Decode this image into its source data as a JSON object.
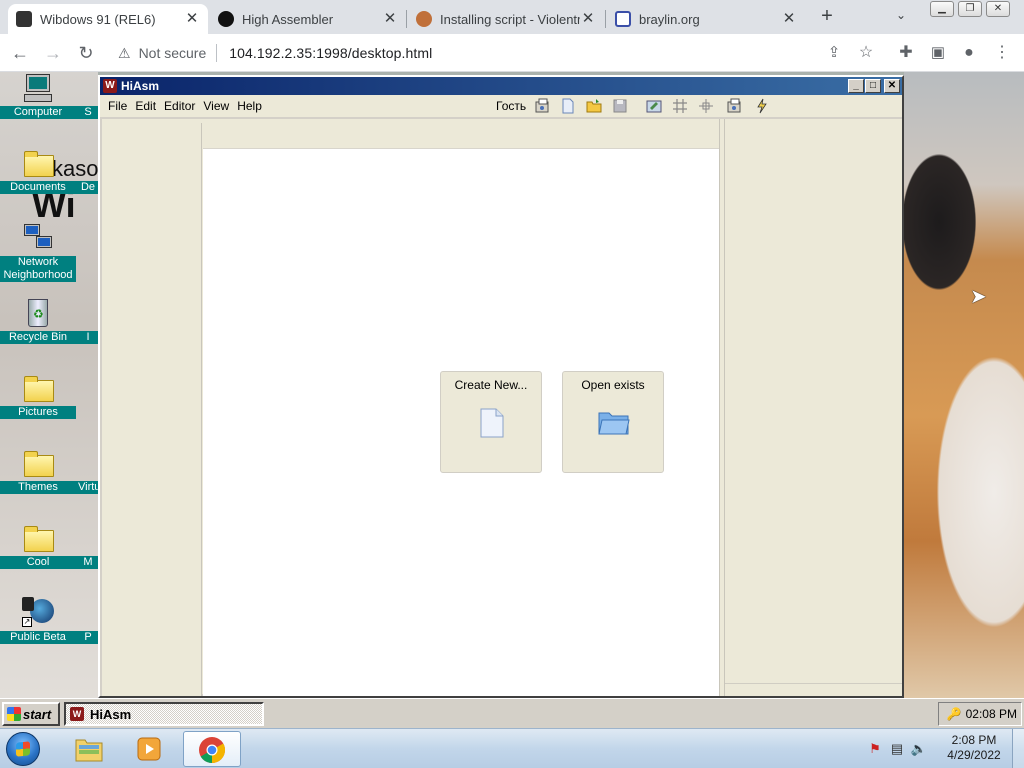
{
  "browser": {
    "tabs": [
      {
        "title": "Wibdows 91 (REL6)",
        "active": true
      },
      {
        "title": "High Assembler",
        "active": false
      },
      {
        "title": "Installing script - Violentm",
        "active": false
      },
      {
        "title": "braylin.org",
        "active": false
      }
    ],
    "new_tab": "+",
    "tab_search": "⌄",
    "address": {
      "security": "Not secure",
      "url": "104.192.2.35:1998/desktop.html"
    }
  },
  "desktop": {
    "icons": [
      {
        "label": "Computer",
        "stub": "S"
      },
      {
        "label": "Documents",
        "stub": "De"
      },
      {
        "label": "Network Neighborhood",
        "stub": ""
      },
      {
        "label": "Recycle Bin",
        "stub": "I"
      },
      {
        "label": "Pictures",
        "stub": ""
      },
      {
        "label": "Themes",
        "stub": "Virtu"
      },
      {
        "label": "Cool",
        "stub": "M"
      },
      {
        "label": "Public Beta",
        "stub": "P"
      }
    ],
    "wallpaper_text": "kaso",
    "wallpaper_text2": "Wi"
  },
  "hiasm": {
    "title": "HiAsm",
    "menu": [
      "File",
      "Edit",
      "Editor",
      "View",
      "Help"
    ],
    "user": "Гость",
    "cards": [
      {
        "label": "Create New..."
      },
      {
        "label": "Open exists"
      }
    ]
  },
  "win98_taskbar": {
    "start": "start",
    "task": "HiAsm",
    "clock": "02:08 PM"
  },
  "win7_taskbar": {
    "time": "2:08 PM",
    "date": "4/29/2022"
  },
  "colors": {
    "desktop_teal": "#008080",
    "title_blue": "#0a246a",
    "chrome_tabstrip": "#dee1e6"
  }
}
